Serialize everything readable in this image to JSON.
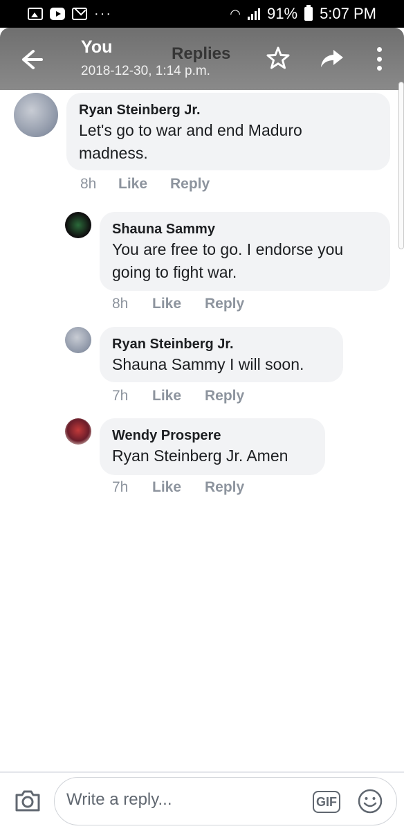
{
  "status_bar": {
    "battery": "91%",
    "time": "5:07 PM",
    "dots": "···"
  },
  "header": {
    "title": "You",
    "subtitle": "Replies",
    "date": "2018-12-30, 1:14 p.m.",
    "back_icon": "back-arrow-icon",
    "star_icon": "star-icon",
    "share_icon": "share-icon",
    "more_icon": "more-vertical-icon"
  },
  "comments": [
    {
      "name": "Ryan Steinberg Jr.",
      "text": "Let's go to war and end Maduro madness.",
      "time": "8h",
      "like": "Like",
      "reply": "Reply"
    },
    {
      "name": "Shauna Sammy",
      "text": "You are free to go. I endorse you going to fight war.",
      "time": "8h",
      "like": "Like",
      "reply": "Reply"
    },
    {
      "name": "Ryan Steinberg Jr.",
      "text": "Shauna Sammy I will soon.",
      "time": "7h",
      "like": "Like",
      "reply": "Reply"
    },
    {
      "name": "Wendy Prospere",
      "text": "Ryan Steinberg Jr. Amen",
      "time": "7h",
      "like": "Like",
      "reply": "Reply"
    }
  ],
  "reply_bar": {
    "placeholder": "Write a reply...",
    "gif_label": "GIF"
  },
  "colors": {
    "bubble": "#f2f3f5",
    "meta_text": "#8d949e",
    "header": "#7a7a7a"
  }
}
